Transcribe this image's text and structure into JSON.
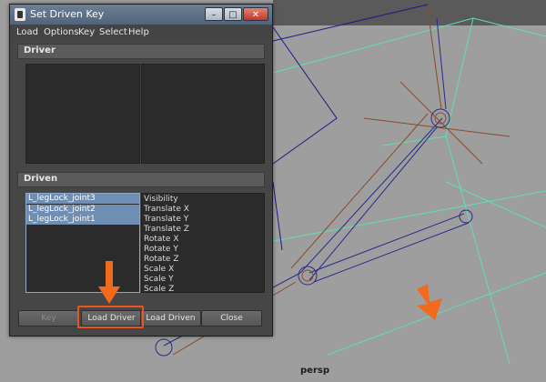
{
  "window": {
    "title": "Set Driven Key"
  },
  "menubar": [
    "Load",
    "Options",
    "Key",
    "Select",
    "Help"
  ],
  "sections": {
    "driver": "Driver",
    "driven": "Driven"
  },
  "driven_objects": [
    "L_legLock_joint3",
    "L_legLock_joint2",
    "L_legLock_joint1"
  ],
  "driven_attributes": [
    "Visibility",
    "Translate X",
    "Translate Y",
    "Translate Z",
    "Rotate X",
    "Rotate Y",
    "Rotate Z",
    "Scale X",
    "Scale Y",
    "Scale Z"
  ],
  "buttons": {
    "key": "Key",
    "load_driver": "Load Driver",
    "load_driven": "Load Driven",
    "close": "Close"
  },
  "viewport": {
    "label": "persp"
  },
  "colors": {
    "annotation": "#f26b1d",
    "selection": "#6e8fb3"
  },
  "icons": {
    "minimize": "minimize-icon",
    "maximize": "maximize-icon",
    "close": "close-icon",
    "arrow": "arrow-down-icon"
  }
}
